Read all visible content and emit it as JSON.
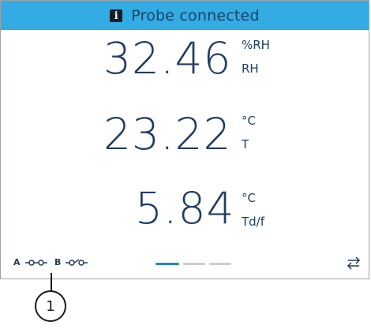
{
  "status": {
    "message": "Probe connected",
    "info_icon_glyph": "i",
    "background_color": "#33ace3"
  },
  "readings": [
    {
      "value": "32.46",
      "unit": "%RH",
      "quantity": "RH"
    },
    {
      "value": "23.22",
      "unit": "°C",
      "quantity": "T"
    },
    {
      "value": "5.84",
      "unit": "°C",
      "quantity": "Td/f"
    }
  ],
  "bottom_bar": {
    "port_a_label": "A",
    "port_b_label": "B",
    "port_icon": "probe-port-icon",
    "page_indicator": {
      "pages": 3,
      "active": 1,
      "active_color": "#1f8ac8",
      "inactive_color": "#c9cdd1"
    },
    "swap_icon": "swap-arrows-icon"
  },
  "callout": {
    "number": "1"
  }
}
